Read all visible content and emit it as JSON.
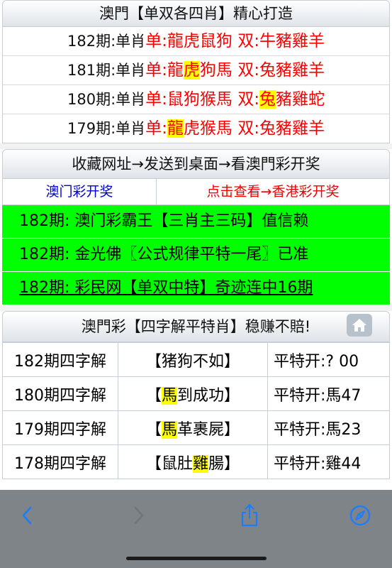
{
  "section1": {
    "title": "澳門【单双各四肖】精心打造",
    "rows": [
      {
        "period": "182期:单肖",
        "dan_label": "单:",
        "dan": [
          "龍",
          "虎",
          "鼠",
          "狗"
        ],
        "shuang_label": "双:",
        "shuang": [
          "牛",
          "豬",
          "雞",
          "羊"
        ]
      },
      {
        "period": "181期:单肖",
        "dan_label": "单:",
        "dan": [
          "龍",
          "虎",
          "狗",
          "馬"
        ],
        "shuang_label": "双:",
        "shuang": [
          "兔",
          "豬",
          "雞",
          "羊"
        ]
      },
      {
        "period": "180期:单肖",
        "dan_label": "单:",
        "dan": [
          "鼠",
          "狗",
          "猴",
          "馬"
        ],
        "shuang_label": "双:",
        "shuang": [
          "兔",
          "豬",
          "雞",
          "蛇"
        ]
      },
      {
        "period": "179期:单肖",
        "dan_label": "单:",
        "dan": [
          "龍",
          "虎",
          "猴",
          "馬"
        ],
        "shuang_label": "双:",
        "shuang": [
          "兔",
          "豬",
          "雞",
          "羊"
        ]
      }
    ]
  },
  "section2": {
    "title": "收藏网址→发送到桌面→看澳門彩开奖",
    "link_left": "澳门彩开奖",
    "link_right": "点击查看→香港彩开奖",
    "items": [
      "182期: 澳门彩霸王【三肖主三码】值信赖",
      "182期: 金光佛〖公式规律平特一尾〗已准",
      "182期: 彩民网【单双中特】奇迹连中16期"
    ]
  },
  "section3": {
    "title": "澳門彩【四字解平特肖】稳赚不賠!",
    "rows": [
      {
        "period": "182期四字解",
        "phrase": [
          "猪",
          "狗",
          "不",
          "如"
        ],
        "result": "平特开:? 00"
      },
      {
        "period": "180期四字解",
        "phrase": [
          "馬",
          "到",
          "成",
          "功"
        ],
        "result": "平特开:馬47"
      },
      {
        "period": "179期四字解",
        "phrase": [
          "馬",
          "革",
          "裹",
          "屍"
        ],
        "result": "平特开:馬23"
      },
      {
        "period": "178期四字解",
        "phrase": [
          "鼠",
          "肚",
          "雞",
          "腸"
        ],
        "result": "平特开:雞44"
      }
    ]
  },
  "colors": {
    "accent_red": "#ff0000",
    "highlight": "#ffff00",
    "green_bar": "#00ff00",
    "link_blue": "#0000cc",
    "toolbar": "#7e8488",
    "toolbar_icon": "#1a7cff"
  },
  "icons": {
    "home": "home-icon",
    "back": "chevron-left-icon",
    "forward": "chevron-right-icon",
    "share": "share-icon",
    "compass": "compass-icon"
  }
}
